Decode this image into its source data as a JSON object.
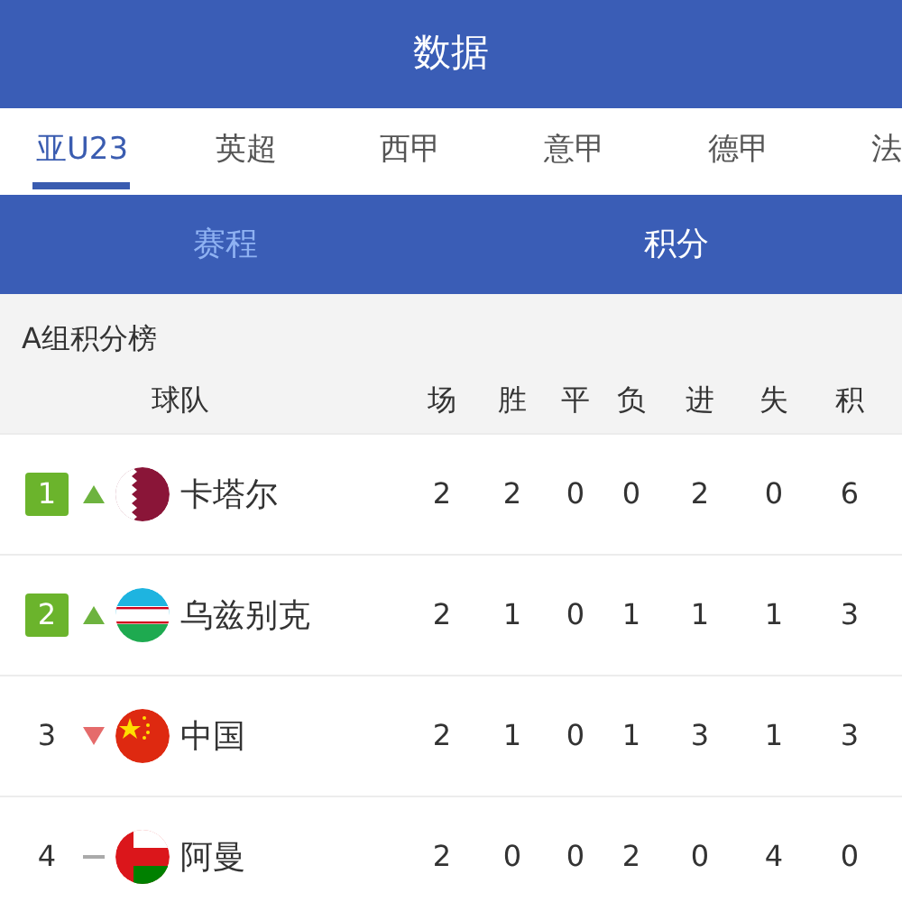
{
  "header": {
    "title": "数据"
  },
  "leagues": [
    {
      "label": "亚U23",
      "selected": true
    },
    {
      "label": "英超",
      "selected": false
    },
    {
      "label": "西甲",
      "selected": false
    },
    {
      "label": "意甲",
      "selected": false
    },
    {
      "label": "德甲",
      "selected": false
    },
    {
      "label": "法",
      "selected": false
    }
  ],
  "views": [
    {
      "label": "赛程",
      "selected": false
    },
    {
      "label": "积分",
      "selected": true
    }
  ],
  "table": {
    "title": "A组积分榜",
    "columns": [
      "球队",
      "场",
      "胜",
      "平",
      "负",
      "进",
      "失",
      "积"
    ],
    "rows": [
      {
        "rank": "1",
        "qualified": true,
        "trend": {
          "kind": "up"
        },
        "flag": {
          "kind": "qatar"
        },
        "cells": [
          "卡塔尔",
          "2",
          "2",
          "0",
          "0",
          "2",
          "0",
          "6"
        ]
      },
      {
        "rank": "2",
        "qualified": true,
        "trend": {
          "kind": "up"
        },
        "flag": {
          "kind": "uzbekistan"
        },
        "cells": [
          "乌兹别克",
          "2",
          "1",
          "0",
          "1",
          "1",
          "1",
          "3"
        ]
      },
      {
        "rank": "3",
        "qualified": false,
        "trend": {
          "kind": "down"
        },
        "flag": {
          "kind": "china"
        },
        "cells": [
          "中国",
          "2",
          "1",
          "0",
          "1",
          "3",
          "1",
          "3"
        ]
      },
      {
        "rank": "4",
        "qualified": false,
        "trend": {
          "kind": "same"
        },
        "flag": {
          "kind": "oman"
        },
        "cells": [
          "阿曼",
          "2",
          "0",
          "0",
          "2",
          "0",
          "4",
          "0"
        ]
      }
    ]
  }
}
